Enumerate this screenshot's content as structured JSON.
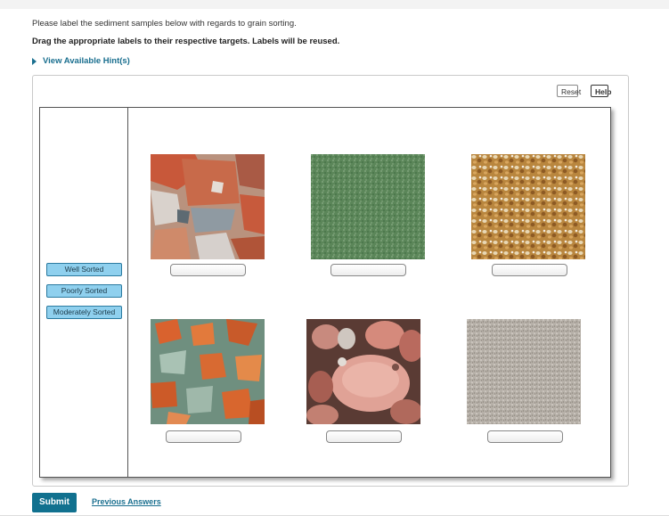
{
  "instructions": {
    "line1": "Please label the sediment samples below with regards to grain sorting.",
    "line2": "Drag the appropriate labels to their respective targets. Labels will be reused."
  },
  "hint": {
    "label": "View Available Hint(s)"
  },
  "toolbar": {
    "reset_label": "Reset",
    "help_label": "Help"
  },
  "labels": [
    "Well Sorted",
    "Poorly Sorted",
    "Moderately Sorted"
  ],
  "samples": [
    {
      "name": "sample-1",
      "texture": "poorly-sorted-angular-red-gray"
    },
    {
      "name": "sample-2",
      "texture": "well-sorted-fine-green"
    },
    {
      "name": "sample-3",
      "texture": "moderately-sorted-tan-grains"
    },
    {
      "name": "sample-4",
      "texture": "poorly-sorted-orange-green"
    },
    {
      "name": "sample-5",
      "texture": "poorly-sorted-pink-pebbles"
    },
    {
      "name": "sample-6",
      "texture": "well-sorted-fine-gray"
    }
  ],
  "footer": {
    "submit_label": "Submit",
    "previous_answers_label": "Previous Answers"
  },
  "colors": {
    "accent": "#11718f",
    "link": "#1a6f8f",
    "label_fill": "#8fd0ee"
  }
}
